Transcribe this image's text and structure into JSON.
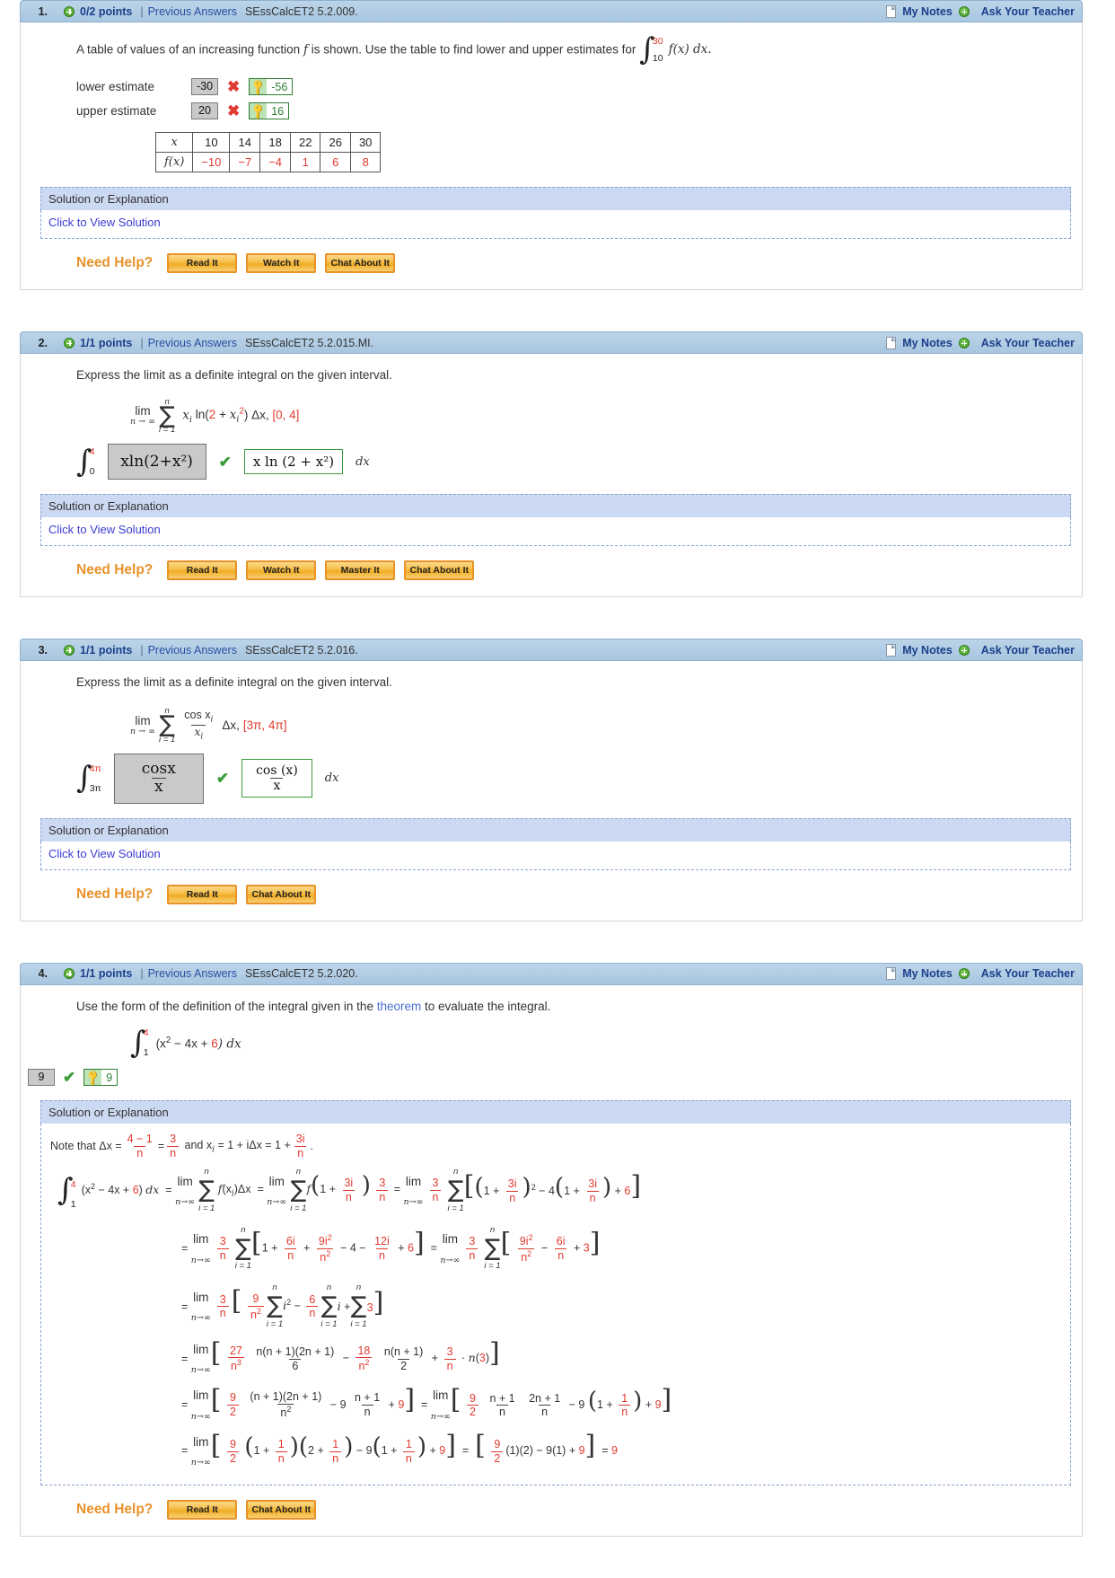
{
  "common": {
    "separator": "|",
    "previous_answers": "Previous Answers",
    "my_notes": "My Notes",
    "ask_your_teacher": "Ask Your Teacher",
    "solution_band": "Solution or Explanation",
    "click_to_view": "Click to View Solution",
    "need_help": "Need Help?",
    "btn_read": "Read It",
    "btn_watch": "Watch It",
    "btn_master": "Master It",
    "btn_chat": "Chat About It",
    "colors": {
      "header_blue": "#a8c6e0",
      "link_blue": "#1b3f8b",
      "math_red": "#e03a30",
      "correct_green": "#3a9c3a",
      "wrong_red": "#e03a30",
      "orange": "#e8922a"
    }
  },
  "problems": [
    {
      "number": "1.",
      "points": "0/2 points",
      "code": "SEssCalcET2 5.2.009.",
      "prompt_pre": "A table of values of an increasing function",
      "prompt_var": "f",
      "prompt_mid": "is shown. Use the table to find lower and upper estimates for",
      "integral": {
        "lower": "10",
        "upper": "30",
        "body": "f(x) dx."
      },
      "answers": [
        {
          "label": "lower estimate",
          "value": "-30",
          "status": "wrong",
          "key": "-56"
        },
        {
          "label": "upper estimate",
          "value": "20",
          "status": "wrong",
          "key": "16"
        }
      ],
      "table": {
        "row_labels": [
          "x",
          "f(x)"
        ],
        "x_values": [
          "10",
          "14",
          "18",
          "22",
          "26",
          "30"
        ],
        "f_values": [
          "−10",
          "−7",
          "−4",
          "1",
          "6",
          "8"
        ]
      },
      "help_buttons": [
        "Read It",
        "Watch It",
        "Chat About It"
      ]
    },
    {
      "number": "2.",
      "points": "1/1 points",
      "code": "SEssCalcET2 5.2.015.MI.",
      "prompt": "Express the limit as a definite integral on the given interval.",
      "limit": {
        "lim": "lim",
        "lim_sub": "n → ∞",
        "sigma_top": "n",
        "sigma_bottom": "i = 1",
        "expr_pre": "x",
        "expr_sub": "i",
        "expr_fn": "ln(2 + x",
        "expr_sup": "2",
        "expr_post": ") Δx,",
        "interval": "[0, 4]"
      },
      "integral": {
        "lower": "0",
        "upper": "4"
      },
      "entered": "xln(2+x²)",
      "rendered": "x ln (2 + x²)",
      "dx": "dx",
      "status": "correct",
      "help_buttons": [
        "Read It",
        "Watch It",
        "Master It",
        "Chat About It"
      ]
    },
    {
      "number": "3.",
      "points": "1/1 points",
      "code": "SEssCalcET2 5.2.016.",
      "prompt": "Express the limit as a definite integral on the given interval.",
      "limit": {
        "lim": "lim",
        "lim_sub": "n → ∞",
        "sigma_top": "n",
        "sigma_bottom": "i = 1",
        "frac_num": "cos x",
        "frac_num_sub": "i",
        "frac_den": "x",
        "frac_den_sub": "i",
        "expr_post": "Δx,",
        "interval": "[3π, 4π]"
      },
      "integral": {
        "lower": "3π",
        "upper": "4π"
      },
      "entered_num": "cosx",
      "entered_den": "x",
      "rendered_num": "cos (x)",
      "rendered_den": "x",
      "dx": "dx",
      "status": "correct",
      "help_buttons": [
        "Read It",
        "Chat About It"
      ]
    },
    {
      "number": "4.",
      "points": "1/1 points",
      "code": "SEssCalcET2 5.2.020.",
      "prompt_pre": "Use the form of the definition of the integral given in the",
      "prompt_link": "theorem",
      "prompt_post": "to evaluate the integral.",
      "integral": {
        "lower": "1",
        "upper": "4",
        "body_pre": "(x",
        "body_sup": "2",
        "body_mid": " − 4x + ",
        "body_red": "6",
        "body_post": ") dx"
      },
      "answer": {
        "value": "9",
        "status": "correct",
        "key": "9"
      },
      "solution": {
        "note_pre": "Note that",
        "note_dx": "Δx =",
        "note_frac1_num": "4 − 1",
        "note_frac1_den": "n",
        "note_eq": "=",
        "note_frac2_num": "3",
        "note_frac2_den": "n",
        "note_and": "and x",
        "note_and_sub": "i",
        "note_and_post": "= 1 + iΔx = 1 +",
        "note_frac3_num": "3i",
        "note_frac3_den": "n",
        "note_end": ".",
        "lines": [
          "∫₁⁴ (x² − 4x + 6) dx = lim(n→∞) Σ f(xᵢ)Δx = lim(n→∞) Σ f(1 + 3i/n)(3/n) = lim(n→∞) (3/n) Σ [(1 + 3i/n)² − 4(1 + 3i/n) + 6]",
          "= lim(n→∞) (3/n) Σ [1 + 6i/n + 9i²/n² − 4 − 12i/n + 6] = lim(n→∞) (3/n) Σ [9i²/n² − 6i/n + 3]",
          "= lim(n→∞) (3/n) [ (9/n²) Σ i² − (6/n) Σ i + Σ 3 ]",
          "= lim(n→∞) [ (27/n³) n(n+1)(2n+1)/6 − (18/n²) n(n+1)/2 + (3/n)·n(3) ]",
          "= lim(n→∞) [ (9/2) (n+1)(2n+1)/n² − 9 (n+1)/n + 9 ] = lim(n→∞) [ (9/2) (n+1)/n (2n+1)/n − 9(1 + 1/n) + 9 ]",
          "= lim(n→∞) [ (9/2)(1 + 1/n)(2 + 1/n) − 9(1 + 1/n) + 9 ] = [ (9/2)(1)(2) − 9(1) + 9 ] = 9"
        ]
      },
      "help_buttons": [
        "Read It",
        "Chat About It"
      ]
    }
  ]
}
